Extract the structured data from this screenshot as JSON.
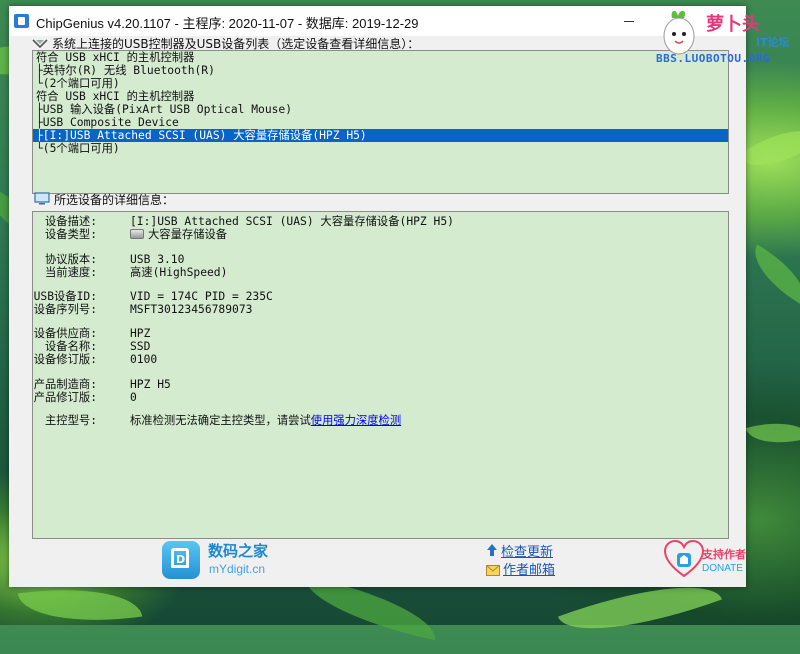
{
  "window": {
    "title": "ChipGenius v4.20.1107 - 主程序: 2020-11-07 - 数据库: 2019-12-29"
  },
  "device_list": {
    "label": "系统上连接的USB控制器及USB设备列表（选定设备查看详细信息）：",
    "items": [
      "符合 USB xHCI 的主机控制器",
      "├英特尔(R) 无线 Bluetooth(R)",
      "└(2个端口可用)",
      "符合 USB xHCI 的主机控制器",
      "├USB 输入设备(PixArt USB Optical Mouse)",
      "├USB Composite Device",
      "├[I:]USB Attached SCSI (UAS) 大容量存储设备(HPZ H5)",
      "└(5个端口可用)"
    ],
    "selected_index": 6
  },
  "details": {
    "label": "所选设备的详细信息：",
    "rows": [
      {
        "label": "设备描述:",
        "value": "[I:]USB Attached SCSI (UAS) 大容量存储设备(HPZ H5)"
      },
      {
        "label": "设备类型:",
        "value": "大容量存储设备"
      },
      {
        "label": "协议版本:",
        "value": "USB 3.10"
      },
      {
        "label": "当前速度:",
        "value": "高速(HighSpeed)"
      },
      {
        "label": "USB设备ID:",
        "value": "VID = 174C PID = 235C"
      },
      {
        "label": "设备序列号:",
        "value": "MSFT30123456789073"
      },
      {
        "label": "设备供应商:",
        "value": "HPZ"
      },
      {
        "label": "设备名称:",
        "value": "SSD"
      },
      {
        "label": "设备修订版:",
        "value": "0100"
      },
      {
        "label": "产品制造商:",
        "value": "HPZ H5"
      },
      {
        "label": "产品修订版:",
        "value": "0"
      },
      {
        "label": "主控型号:",
        "value": "标准检测无法确定主控类型，请尝试",
        "link": "使用强力深度检测"
      }
    ]
  },
  "footer": {
    "site_name": "数码之家",
    "site_url": "mYdigit.cn",
    "check_update": "检查更新",
    "author_email": "作者邮箱",
    "support_author": "支持作者",
    "donate": "DONATE"
  },
  "watermark": {
    "brand": "萝卜头",
    "sub": "IT论坛",
    "url": "BBS.LUOBOTOU.ORG"
  },
  "colors": {
    "panel_bg": "#d4ebd0",
    "selection": "#0a64c8",
    "link": "#0000ee"
  }
}
